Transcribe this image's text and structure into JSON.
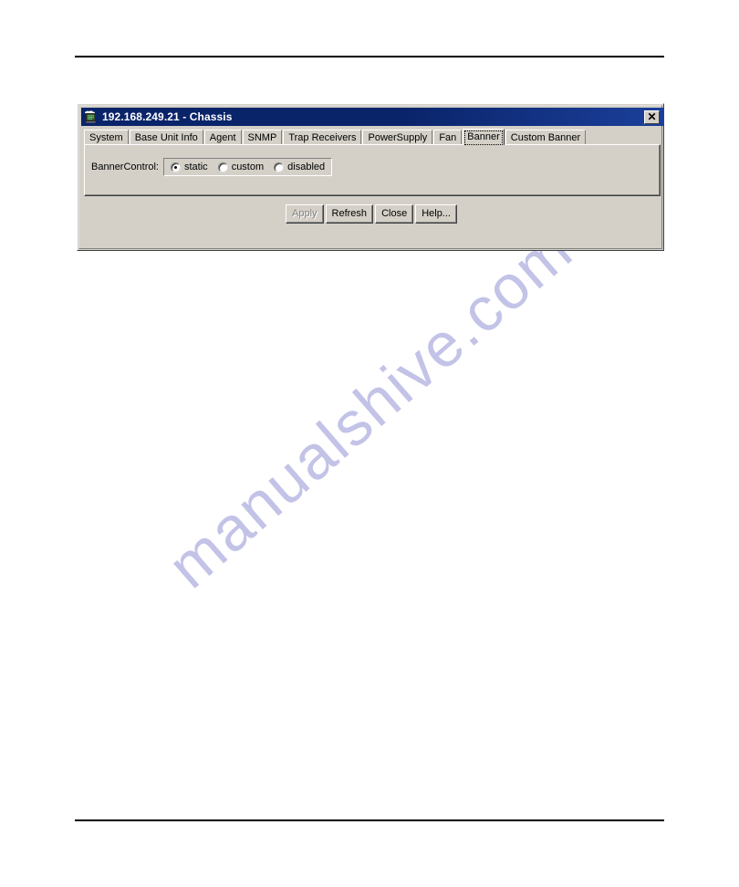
{
  "page": {
    "watermark": "manualshive.com",
    "rules": [
      "top-rule",
      "bottom-rule"
    ]
  },
  "window": {
    "title": "192.168.249.21 - Chassis",
    "icon": "chassis-device-icon",
    "close_label": "✕",
    "colors": {
      "titlebar": "#0a246a",
      "face": "#d4d0c8",
      "shadow": "#808080",
      "dark_shadow": "#404040",
      "highlight": "#ffffff",
      "text": "#000000",
      "disabled_text": "#808080",
      "watermark": "#c3c3e8"
    }
  },
  "tabs": [
    {
      "label": "System",
      "active": false
    },
    {
      "label": "Base Unit Info",
      "active": false
    },
    {
      "label": "Agent",
      "active": false
    },
    {
      "label": "SNMP",
      "active": false
    },
    {
      "label": "Trap Receivers",
      "active": false
    },
    {
      "label": "PowerSupply",
      "active": false
    },
    {
      "label": "Fan",
      "active": false
    },
    {
      "label": "Banner",
      "active": true
    },
    {
      "label": "Custom Banner",
      "active": false
    }
  ],
  "banner_panel": {
    "control_label": "BannerControl:",
    "selected": "static",
    "options": [
      {
        "value": "static",
        "label": "static",
        "checked": true
      },
      {
        "value": "custom",
        "label": "custom",
        "checked": false
      },
      {
        "value": "disabled",
        "label": "disabled",
        "checked": false
      }
    ]
  },
  "buttons": [
    {
      "label": "Apply",
      "disabled": true
    },
    {
      "label": "Refresh",
      "disabled": false
    },
    {
      "label": "Close",
      "disabled": false
    },
    {
      "label": "Help...",
      "disabled": false
    }
  ]
}
